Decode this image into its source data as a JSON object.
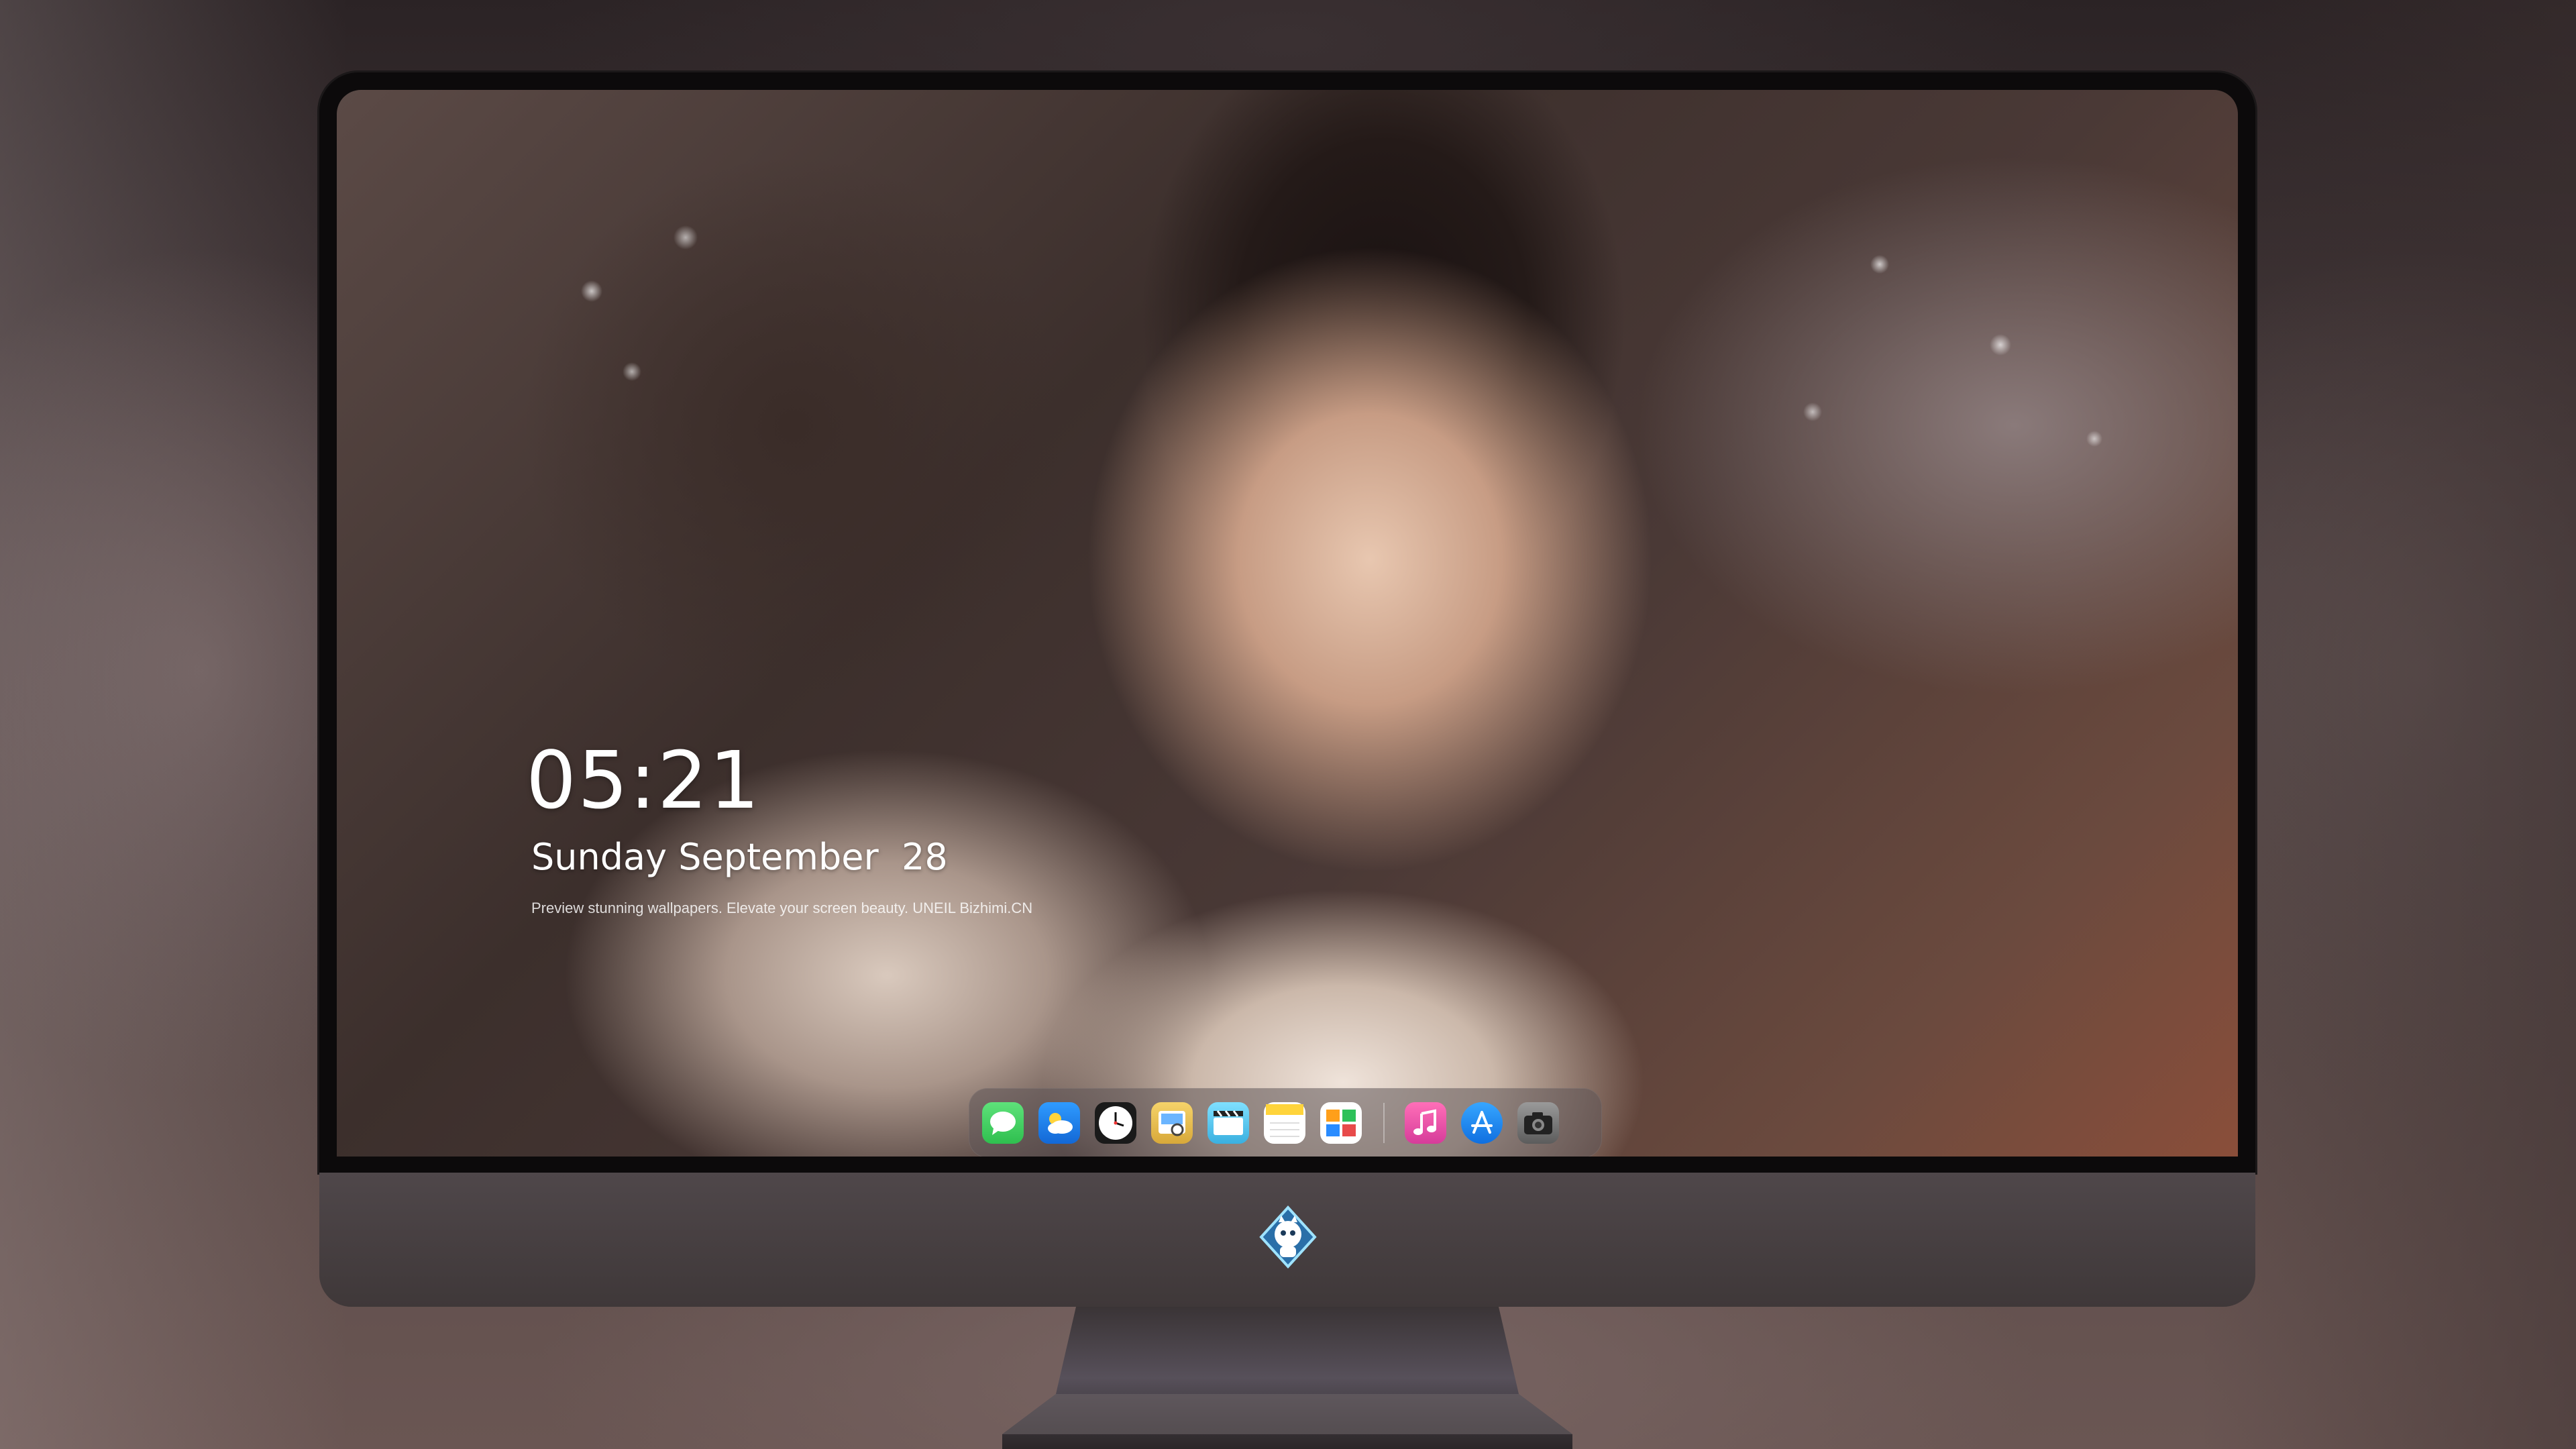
{
  "lockscreen": {
    "time": "05:21",
    "date": "Sunday September  28",
    "tagline": "Preview stunning wallpapers. Elevate your screen beauty. UNEIL  Bizhimi.CN"
  },
  "dock": {
    "apps": [
      {
        "name": "messages-icon"
      },
      {
        "name": "weather-icon"
      },
      {
        "name": "clock-icon"
      },
      {
        "name": "preview-icon"
      },
      {
        "name": "clips-icon"
      },
      {
        "name": "notes-icon"
      },
      {
        "name": "calendar-icon"
      },
      {
        "name": "music-icon"
      },
      {
        "name": "app-store-icon"
      },
      {
        "name": "camera-icon"
      }
    ]
  },
  "colors": {
    "messages": "#34c759",
    "weather": "#1e8fff",
    "music": "#f655a6",
    "app_store": "#1a8cff"
  }
}
